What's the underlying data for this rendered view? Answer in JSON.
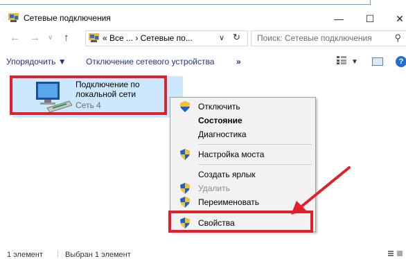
{
  "window": {
    "title": "Сетевые подключения"
  },
  "address": {
    "crumbs": "« Все ... › Сетевые по..."
  },
  "search": {
    "placeholder": "Поиск: Сетевые подключения"
  },
  "toolbar": {
    "organize": "Упорядочить ▼",
    "disable_device": "Отключение сетевого устройства",
    "more": "»"
  },
  "item": {
    "name_line1": "Подключение по",
    "name_line2": "локальной сети",
    "network": "Сеть 4"
  },
  "context_menu": {
    "items": [
      {
        "label": "Отключить",
        "shield": true,
        "style": "normal"
      },
      {
        "label": "Состояние",
        "shield": false,
        "style": "bold"
      },
      {
        "label": "Диагностика",
        "shield": false,
        "style": "normal"
      },
      {
        "label": "Настройка моста",
        "shield": true,
        "style": "normal"
      },
      {
        "label": "Создать ярлык",
        "shield": false,
        "style": "normal"
      },
      {
        "label": "Удалить",
        "shield": true,
        "style": "disabled"
      },
      {
        "label": "Переименовать",
        "shield": true,
        "style": "normal"
      },
      {
        "label": "Свойства",
        "shield": true,
        "style": "normal"
      }
    ]
  },
  "statusbar": {
    "count": "1 элемент",
    "selected": "Выбран 1 элемент"
  },
  "colors": {
    "highlight_box": "#e0212c",
    "selection": "#cce8ff",
    "link": "#1e3287"
  }
}
